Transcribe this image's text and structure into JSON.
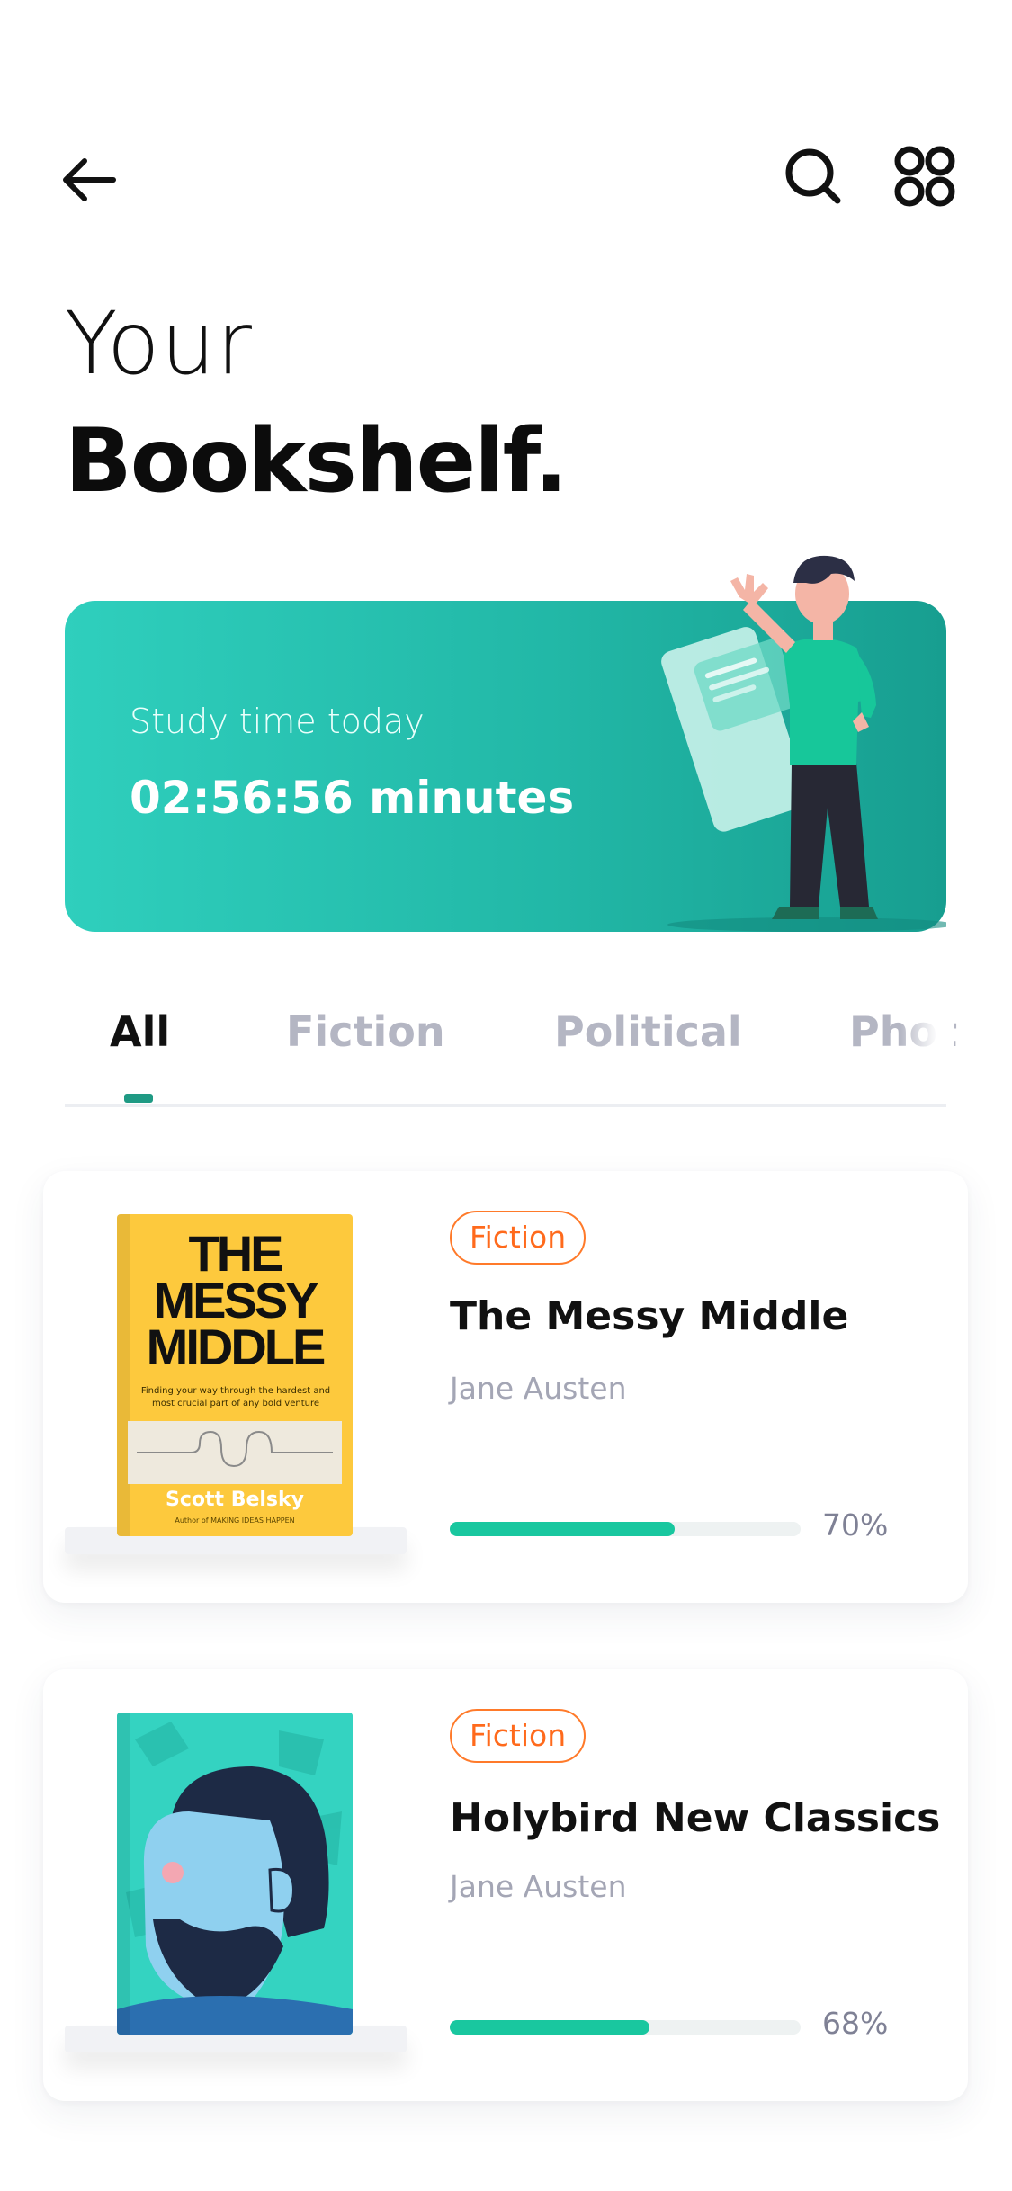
{
  "header": {
    "title_line1": "Your",
    "title_line2": "Bookshelf.",
    "icons": {
      "back": "arrow-left-icon",
      "search": "search-icon",
      "menu": "grid-icon"
    }
  },
  "study_card": {
    "label": "Study time today",
    "value": "02:56:56 minutes",
    "colors": {
      "start": "#2fcfbd",
      "end": "#179e90"
    }
  },
  "tabs": [
    {
      "label": "All",
      "active": true
    },
    {
      "label": "Fiction",
      "active": false
    },
    {
      "label": "Political",
      "active": false
    },
    {
      "label": "Phot",
      "active": false
    }
  ],
  "books": [
    {
      "tag": "Fiction",
      "title": "The Messy Middle",
      "author": "Jane Austen",
      "progress_text": "70%",
      "progress_fraction": 0.64,
      "cover": {
        "title": "THE MESSY MIDDLE",
        "subtitle": "Finding your way through the hardest and most crucial part of any bold venture",
        "author": "Scott Belsky",
        "tagline": "Author of MAKING IDEAS HAPPEN"
      }
    },
    {
      "tag": "Fiction",
      "title": "Holybird New Classics",
      "author": "Jane Austen",
      "progress_text": "68%",
      "progress_fraction": 0.57
    }
  ],
  "colors": {
    "accent": "#19c79f",
    "tag": "#ff6a1c",
    "tab_active_indicator": "#1f9a84"
  }
}
